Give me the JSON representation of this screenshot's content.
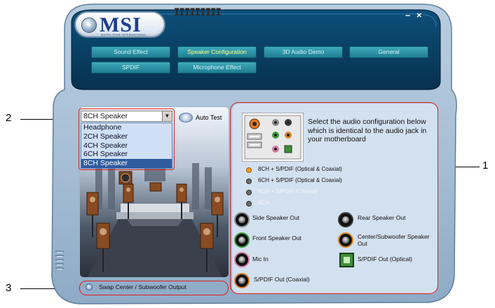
{
  "logo": {
    "text": "MSI",
    "subtitle": "MICRO-STAR INTERNATIONAL"
  },
  "window_controls": {
    "minimize": "–",
    "close": "×"
  },
  "nav_tabs": [
    {
      "label": "Sound Effect",
      "active": false
    },
    {
      "label": "Speaker Configuration",
      "active": true
    },
    {
      "label": "3D Audio Demo",
      "active": false
    },
    {
      "label": "General",
      "active": false
    },
    {
      "label": "SPDIF",
      "active": false
    },
    {
      "label": "Microphone Effect",
      "active": false
    }
  ],
  "speaker_select": {
    "value": "8CH Speaker",
    "options": [
      "Headphone",
      "2CH Speaker",
      "4CH Speaker",
      "6CH Speaker",
      "8CH Speaker"
    ],
    "selected_index": 4
  },
  "auto_test": {
    "label": "Auto Test"
  },
  "swap_option": {
    "label": "Swap Center / Subwoofer Output"
  },
  "right_panel": {
    "description": "Select the audio configuration below which is identical to the audio jack in your motherboard",
    "configs": [
      {
        "label": "8CH + S/PDIF (Optical & Coaxial)",
        "selected": true,
        "enabled": true
      },
      {
        "label": "6CH + S/PDIF (Optical & Coaxial)",
        "selected": false,
        "enabled": true
      },
      {
        "label": "6CH + S/PDIF (Coaxial)",
        "selected": false,
        "enabled": false
      },
      {
        "label": "6CH",
        "selected": false,
        "enabled": false
      }
    ],
    "jacks": [
      {
        "label": "Side Speaker Out",
        "ring_color": "#8c8c8c"
      },
      {
        "label": "Rear Speaker Out",
        "ring_color": "#3a3a3a"
      },
      {
        "label": "Front Speaker Out",
        "ring_color": "#3d9b3d"
      },
      {
        "label": "Center/Subwoofer Speaker Out",
        "ring_color": "#d9891f"
      },
      {
        "label": "Mic In",
        "ring_color": "#d47aa0"
      },
      {
        "label": "S/PDIF Out (Optical)",
        "ring_color": "#3f8e3a"
      },
      {
        "label": "S/PDIF Out (Coaxial)",
        "ring_color": "#e07a2a"
      }
    ]
  },
  "callouts": {
    "one": "1",
    "two": "2",
    "three": "3"
  },
  "colors": {
    "accent": "#1e7e92",
    "active_tab_text": "#ffff80",
    "callout_red": "#e02020",
    "selected_dot": "#f39a1e"
  }
}
